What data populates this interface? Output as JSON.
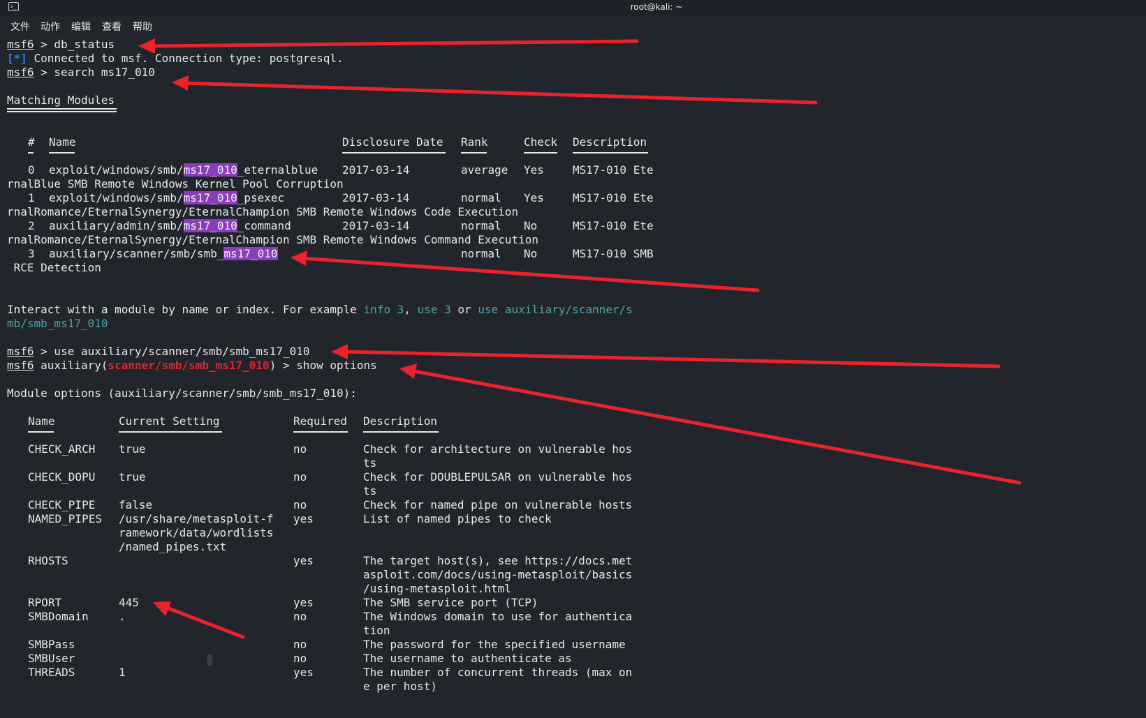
{
  "window": {
    "title": "root@kali: ~",
    "icon": "terminal-icon"
  },
  "menu": [
    "文件",
    "动作",
    "编辑",
    "查看",
    "帮助"
  ],
  "colors": {
    "background": "#22252c",
    "highlight": "#8a3dbd",
    "accent_blue": "#2f7df0",
    "module_red": "#e0242d",
    "hint_cyan": "#4aa5a8",
    "arrow_red": "#e8232c"
  },
  "session": {
    "prompt": "msf6",
    "cmd1": " > db_status",
    "status_tag": "[*]",
    "status_msg": " Connected to msf. Connection type: postgresql.",
    "cmd2": " > search ms17_010",
    "matching_title": "Matching Modules"
  },
  "modules": {
    "headers": [
      "#",
      "Name",
      "Disclosure Date",
      "Rank",
      "Check",
      "Description"
    ],
    "rows": [
      {
        "idx": "0",
        "pre": "exploit/windows/smb/",
        "hl": "ms17_010",
        "post": "_eternalblue",
        "date": "2017-03-14",
        "rank": "average",
        "check": "Yes",
        "desc": "MS17-010 Ete",
        "wrap": "rnalBlue SMB Remote Windows Kernel Pool Corruption"
      },
      {
        "idx": "1",
        "pre": "exploit/windows/smb/",
        "hl": "ms17_010",
        "post": "_psexec",
        "date": "2017-03-14",
        "rank": "normal",
        "check": "Yes",
        "desc": "MS17-010 Ete",
        "wrap": "rnalRomance/EternalSynergy/EternalChampion SMB Remote Windows Code Execution"
      },
      {
        "idx": "2",
        "pre": "auxiliary/admin/smb/",
        "hl": "ms17_010",
        "post": "_command",
        "date": "2017-03-14",
        "rank": "normal",
        "check": "No",
        "desc": "MS17-010 Ete",
        "wrap": "rnalRomance/EternalSynergy/EternalChampion SMB Remote Windows Command Execution"
      },
      {
        "idx": "3",
        "pre": "auxiliary/scanner/smb/smb_",
        "hl": "ms17_010",
        "post": "",
        "date": "",
        "rank": "normal",
        "check": "No",
        "desc": "MS17-010 SMB",
        "wrap": " RCE Detection"
      }
    ]
  },
  "hint": {
    "a": "Interact with a module by name or index. For example ",
    "b": "info 3",
    "c": ", ",
    "d": "use 3",
    "e": " or ",
    "f": "use auxiliary/scanner/s",
    "g": "mb/smb_ms17_010"
  },
  "session2": {
    "cmd3": " > use auxiliary/scanner/smb/smb_ms17_010",
    "aux_open": " auxiliary(",
    "module": "scanner/smb/smb_ms17_010",
    "aux_close": ") > show options",
    "options_title": "Module options (auxiliary/scanner/smb/smb_ms17_010):"
  },
  "options": {
    "headers": [
      "Name",
      "Current Setting",
      "Required",
      "Description"
    ],
    "rows": [
      {
        "name": "CHECK_ARCH",
        "setting": [
          "true"
        ],
        "req": "no",
        "desc": [
          "Check for architecture on vulnerable hos",
          "ts"
        ]
      },
      {
        "name": "CHECK_DOPU",
        "setting": [
          "true"
        ],
        "req": "no",
        "desc": [
          "Check for DOUBLEPULSAR on vulnerable hos",
          "ts"
        ]
      },
      {
        "name": "CHECK_PIPE",
        "setting": [
          "false"
        ],
        "req": "no",
        "desc": [
          "Check for named pipe on vulnerable hosts"
        ]
      },
      {
        "name": "NAMED_PIPES",
        "setting": [
          "/usr/share/metasploit-f",
          "ramework/data/wordlists",
          "/named_pipes.txt"
        ],
        "req": "yes",
        "desc": [
          "List of named pipes to check"
        ]
      },
      {
        "name": "RHOSTS",
        "setting": [
          ""
        ],
        "req": "yes",
        "desc": [
          "The target host(s), see https://docs.met",
          "asploit.com/docs/using-metasploit/basics",
          "/using-metasploit.html"
        ]
      },
      {
        "name": "RPORT",
        "setting": [
          "445"
        ],
        "req": "yes",
        "desc": [
          "The SMB service port (TCP)"
        ]
      },
      {
        "name": "SMBDomain",
        "setting": [
          "."
        ],
        "req": "no",
        "desc": [
          "The Windows domain to use for authentica",
          "tion"
        ]
      },
      {
        "name": "SMBPass",
        "setting": [
          ""
        ],
        "req": "no",
        "desc": [
          "The password for the specified username"
        ]
      },
      {
        "name": "SMBUser",
        "setting": [
          ""
        ],
        "req": "no",
        "desc": [
          "The username to authenticate as"
        ]
      },
      {
        "name": "THREADS",
        "setting": [
          "1"
        ],
        "req": "yes",
        "desc": [
          "The number of concurrent threads (max on",
          "e per host)"
        ]
      }
    ]
  }
}
